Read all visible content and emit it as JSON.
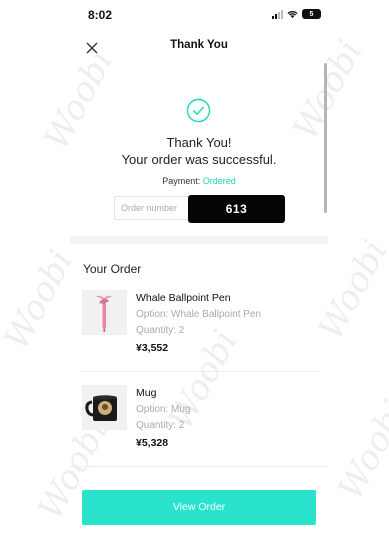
{
  "status_bar": {
    "time": "8:02",
    "battery": "5"
  },
  "header": {
    "title": "Thank You",
    "close_icon": "close-icon"
  },
  "success": {
    "icon": "check-circle-icon",
    "line1": "Thank You!",
    "line2": "Your order was successful.",
    "payment_label": "Payment:",
    "payment_status": "Ordered",
    "order_number_label": "Order number",
    "order_number_value": "613"
  },
  "order": {
    "heading": "Your Order",
    "items": [
      {
        "name": "Whale Ballpoint Pen",
        "option": "Option: Whale Ballpoint Pen",
        "quantity": "Quantity: 2",
        "price": "¥3,552",
        "thumb": "pen-image"
      },
      {
        "name": "Mug",
        "option": "Option: Mug",
        "quantity": "Quantity: 2",
        "price": "¥5,328",
        "thumb": "mug-image"
      }
    ]
  },
  "cta": {
    "label": "View Order"
  },
  "watermark": "Woobi",
  "colors": {
    "accent": "#29e3cc",
    "status_text": "#1fcfb8",
    "check": "#2ed6c1"
  }
}
